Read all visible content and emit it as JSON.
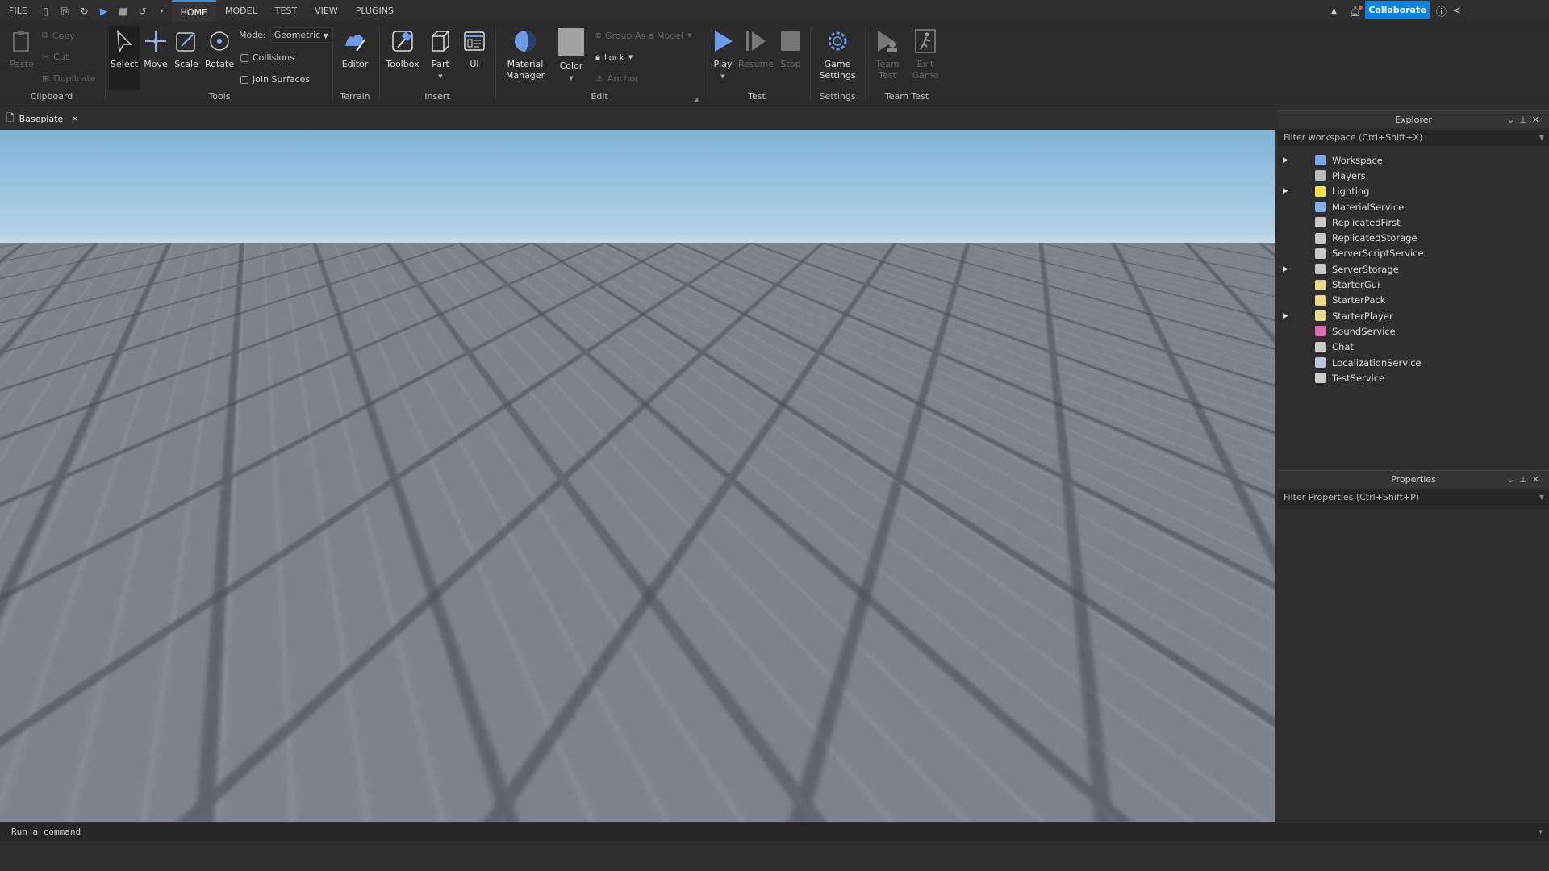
{
  "menu": {
    "file": "FILE",
    "tabs": [
      "HOME",
      "MODEL",
      "TEST",
      "VIEW",
      "PLUGINS"
    ],
    "active_tab": "HOME"
  },
  "topright": {
    "collaborate": "Collaborate"
  },
  "ribbon": {
    "clipboard": {
      "label": "Clipboard",
      "paste": "Paste",
      "copy": "Copy",
      "cut": "Cut",
      "duplicate": "Duplicate"
    },
    "tools": {
      "label": "Tools",
      "select": "Select",
      "move": "Move",
      "scale": "Scale",
      "rotate": "Rotate",
      "mode_label": "Mode:",
      "mode_value": "Geometric",
      "collisions": "Collisions",
      "join_surfaces": "Join Surfaces"
    },
    "terrain": {
      "label": "Terrain",
      "editor": "Editor"
    },
    "insert": {
      "label": "Insert",
      "toolbox": "Toolbox",
      "part": "Part",
      "ui": "UI"
    },
    "edit": {
      "label": "Edit",
      "material_manager": "Material Manager",
      "color": "Color",
      "group": "Group As a Model",
      "lock": "Lock",
      "anchor": "Anchor"
    },
    "test": {
      "label": "Test",
      "play": "Play",
      "resume": "Resume",
      "stop": "Stop"
    },
    "settings": {
      "label": "Settings",
      "game_settings": "Game Settings"
    },
    "team_test": {
      "label": "Team Test",
      "team_test": "Team Test",
      "exit_game": "Exit Game"
    }
  },
  "document_tab": {
    "name": "Baseplate"
  },
  "explorer": {
    "title": "Explorer",
    "filter_placeholder": "Filter workspace (Ctrl+Shift+X)",
    "items": [
      {
        "name": "Workspace",
        "expandable": true,
        "color": "#7aa6e6"
      },
      {
        "name": "Players",
        "expandable": false,
        "color": "#bbbbbb"
      },
      {
        "name": "Lighting",
        "expandable": true,
        "color": "#f2e34a"
      },
      {
        "name": "MaterialService",
        "expandable": false,
        "color": "#8aaee0"
      },
      {
        "name": "ReplicatedFirst",
        "expandable": false,
        "color": "#c8c8c8"
      },
      {
        "name": "ReplicatedStorage",
        "expandable": false,
        "color": "#c8c8c8"
      },
      {
        "name": "ServerScriptService",
        "expandable": false,
        "color": "#c8c8c8"
      },
      {
        "name": "ServerStorage",
        "expandable": true,
        "color": "#c8c8c8"
      },
      {
        "name": "StarterGui",
        "expandable": false,
        "color": "#e8dc8a"
      },
      {
        "name": "StarterPack",
        "expandable": false,
        "color": "#e8dc8a"
      },
      {
        "name": "StarterPlayer",
        "expandable": true,
        "color": "#e8dc8a"
      },
      {
        "name": "SoundService",
        "expandable": false,
        "color": "#d96fb0"
      },
      {
        "name": "Chat",
        "expandable": false,
        "color": "#cccccc"
      },
      {
        "name": "LocalizationService",
        "expandable": false,
        "color": "#b8c6da"
      },
      {
        "name": "TestService",
        "expandable": false,
        "color": "#cccccc"
      }
    ]
  },
  "properties": {
    "title": "Properties",
    "filter_placeholder": "Filter Properties (Ctrl+Shift+P)"
  },
  "command_bar": {
    "placeholder": "Run a command"
  }
}
